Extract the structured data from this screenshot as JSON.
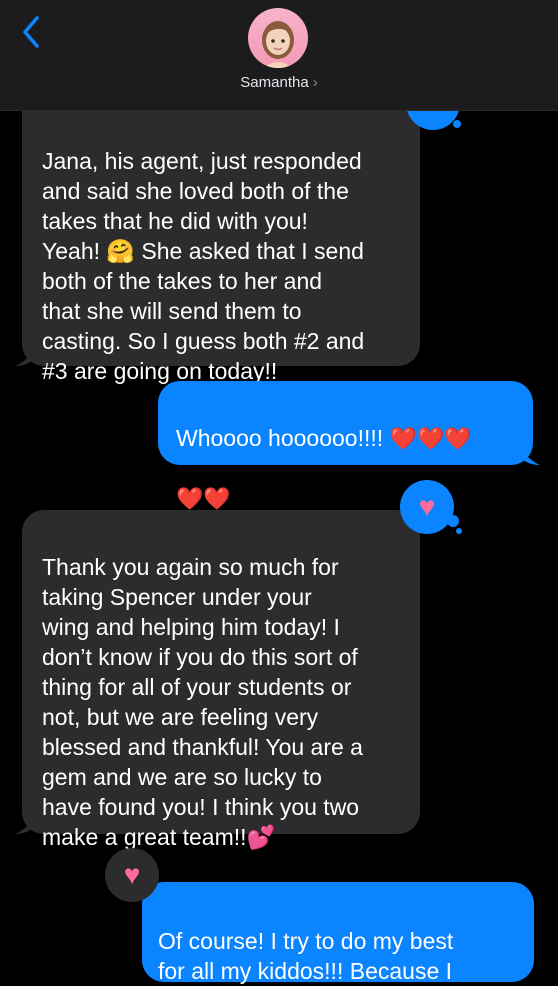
{
  "header": {
    "contact_name": "Samantha",
    "chevron": "›"
  },
  "messages": {
    "m1": "Jana, his agent, just responded\nand said she loved both of the\ntakes that he did with you!\nYeah! 🤗 She asked that I send\nboth of the takes to her and\nthat she will send them to\ncasting. So I guess both #2 and\n#3 are going on today!!",
    "m2_text": "Whoooo hoooooo!!!! ",
    "m2_hearts_line1": "❤️❤️❤️",
    "m2_hearts_line2": "❤️❤️",
    "m3": "Thank you again so much for\ntaking Spencer under your\nwing and helping him today! I\ndon’t know if you do this sort of\nthing for all of your students or\nnot, but we are feeling very\nblessed and thankful! You are a\ngem and we are so lucky to\nhave found you! I think you two\nmake a great team!!💕",
    "m4": "Of course! I try to do my best\nfor all my kiddos!!! Because I"
  },
  "tapbacks": {
    "heart": "♥"
  },
  "colors": {
    "incoming": "#2c2c2e",
    "outgoing": "#0a84ff",
    "accent": "#0a84ff",
    "heart": "#ff6b9d"
  }
}
